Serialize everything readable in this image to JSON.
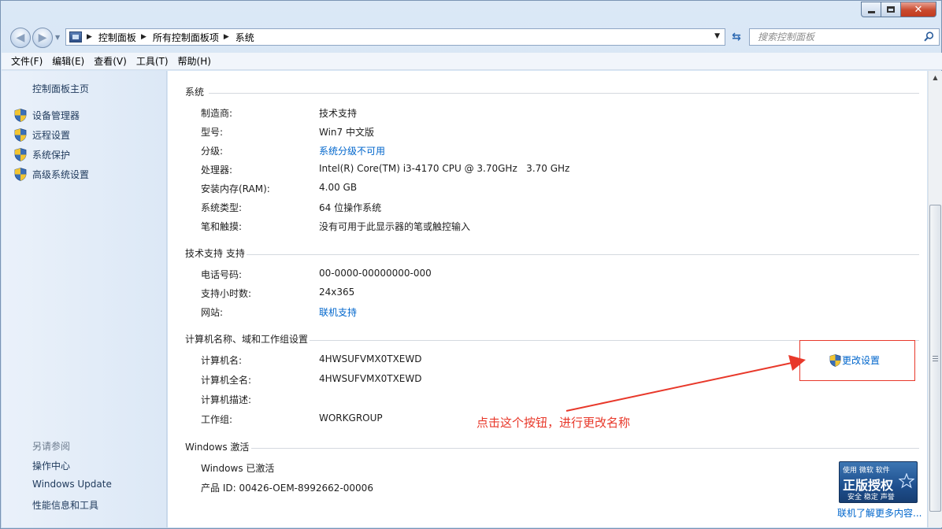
{
  "nav": {
    "breadcrumbs": [
      "控制面板",
      "所有控制面板项",
      "系统"
    ],
    "search_placeholder": "搜索控制面板"
  },
  "menu": [
    "文件(F)",
    "编辑(E)",
    "查看(V)",
    "工具(T)",
    "帮助(H)"
  ],
  "left_pane": {
    "home": "控制面板主页",
    "tasks": [
      "设备管理器",
      "远程设置",
      "系统保护",
      "高级系统设置"
    ],
    "see_also_title": "另请参阅",
    "see_also": [
      "操作中心",
      "Windows Update",
      "性能信息和工具"
    ]
  },
  "system": {
    "heading": "系统",
    "rows": [
      {
        "label": "制造商:",
        "value": "技术支持"
      },
      {
        "label": "型号:",
        "value": "Win7 中文版"
      },
      {
        "label": "分级:",
        "value": "系统分级不可用"
      },
      {
        "label": "处理器:",
        "value": "Intel(R) Core(TM) i3-4170 CPU @ 3.70GHz   3.70 GHz"
      },
      {
        "label": "安装内存(RAM):",
        "value": "4.00 GB"
      },
      {
        "label": "系统类型:",
        "value": "64 位操作系统"
      },
      {
        "label": "笔和触摸:",
        "value": "没有可用于此显示器的笔或触控输入"
      }
    ]
  },
  "support": {
    "heading": "技术支持 支持",
    "rows": [
      {
        "label": "电话号码:",
        "value": "00-0000-00000000-000"
      },
      {
        "label": "支持小时数:",
        "value": "24x365"
      },
      {
        "label": "网站:",
        "value": "联机支持"
      }
    ]
  },
  "computer": {
    "heading": "计算机名称、域和工作组设置",
    "change_settings": "更改设置",
    "rows": [
      {
        "label": "计算机名:",
        "value": "4HWSUFVMX0TXEWD"
      },
      {
        "label": "计算机全名:",
        "value": "4HWSUFVMX0TXEWD"
      },
      {
        "label": "计算机描述:",
        "value": ""
      },
      {
        "label": "工作组:",
        "value": "WORKGROUP"
      }
    ]
  },
  "activation": {
    "heading": "Windows 激活",
    "status": "Windows 已激活",
    "product_id": "产品 ID: 00426-OEM-8992662-00006",
    "badge_top": "使用 微软 软件",
    "badge_main": "正版授权",
    "badge_sub": "安全 稳定 声誉",
    "more_online": "联机了解更多内容..."
  },
  "annotation": "点击这个按钮，进行更改名称",
  "colors": {
    "link": "#0066cc",
    "annotation": "#e8382a"
  }
}
